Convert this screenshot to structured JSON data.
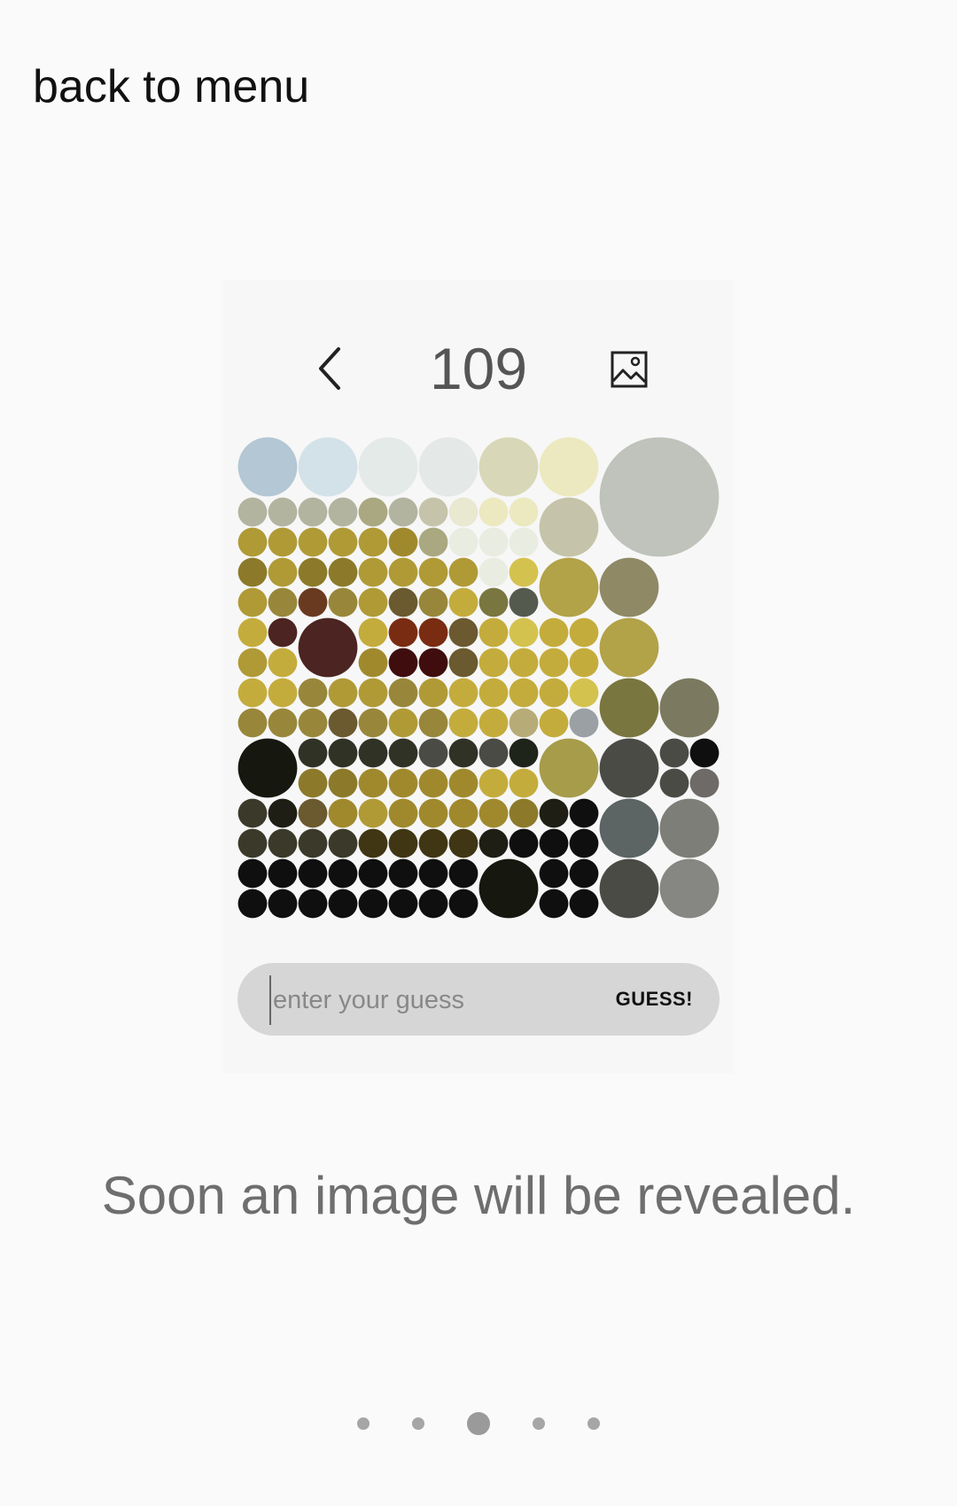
{
  "header": {
    "back_label": "back to menu"
  },
  "puzzle": {
    "counter": "109",
    "guess_placeholder": "enter your guess",
    "guess_value": "",
    "guess_button": "GUESS!",
    "icons": {
      "back": "chevron-left-icon",
      "image": "image-icon"
    },
    "circle_grid": {
      "cells": 16,
      "palette": {
        "a": "#b3c7d4",
        "b": "#d3e2e8",
        "c": "#e3eae8",
        "d": "#e4e8e6",
        "e": "#d8d8b8",
        "f": "#ece9c0",
        "g": "#bfc3bb",
        "h": "#b2b49f",
        "i": "#a9a880",
        "j": "#c5c4aa",
        "k": "#b09a36",
        "l": "#a0892d",
        "m": "#8c7a2a",
        "n": "#98873a",
        "o": "#c4ac3c",
        "p": "#d4c24e",
        "q": "#b2a248",
        "r": "#8f8966",
        "s": "#6a3a20",
        "t": "#4c2421",
        "u": "#7a2c12",
        "v": "#3f0d0d",
        "w": "#6b5a2f",
        "x": "#7a7640",
        "y": "#7b7a60",
        "z": "#555a4f",
        "A": "#3b3a2a",
        "B": "#16170f",
        "C": "#2f3225",
        "D": "#5c6464",
        "E": "#7e7e78",
        "F": "#a69c4a",
        "G": "#4b4b46",
        "H": "#1e1e14",
        "I": "#0f0f0f",
        "J": "#403614",
        "K": "#6d6a68",
        "L": "#868682",
        "M": "#6f6f6c",
        "N": "#b7ab77",
        "O": "#9aa0a4",
        "P": "#e9ece0",
        "Q": "#e9e8d0",
        "R": "#a9bfcc",
        "S": "#1f241b",
        "T": "#8c8f84"
      },
      "circles": [
        [
          0,
          0,
          2,
          "a"
        ],
        [
          2,
          0,
          2,
          "b"
        ],
        [
          4,
          0,
          2,
          "c"
        ],
        [
          6,
          0,
          2,
          "d"
        ],
        [
          8,
          0,
          2,
          "e"
        ],
        [
          10,
          0,
          2,
          "f"
        ],
        [
          12,
          0,
          4,
          "g"
        ],
        [
          0,
          2,
          1,
          "h"
        ],
        [
          1,
          2,
          1,
          "h"
        ],
        [
          2,
          2,
          1,
          "h"
        ],
        [
          3,
          2,
          1,
          "h"
        ],
        [
          4,
          2,
          1,
          "i"
        ],
        [
          5,
          2,
          1,
          "h"
        ],
        [
          6,
          2,
          1,
          "j"
        ],
        [
          7,
          2,
          1,
          "Q"
        ],
        [
          8,
          2,
          1,
          "f"
        ],
        [
          9,
          2,
          1,
          "f"
        ],
        [
          10,
          2,
          2,
          "j"
        ],
        [
          0,
          3,
          1,
          "k"
        ],
        [
          1,
          3,
          1,
          "k"
        ],
        [
          2,
          3,
          1,
          "k"
        ],
        [
          3,
          3,
          1,
          "k"
        ],
        [
          4,
          3,
          1,
          "k"
        ],
        [
          5,
          3,
          1,
          "l"
        ],
        [
          6,
          3,
          1,
          "i"
        ],
        [
          7,
          3,
          1,
          "P"
        ],
        [
          8,
          3,
          1,
          "P"
        ],
        [
          9,
          3,
          1,
          "P"
        ],
        [
          0,
          4,
          1,
          "m"
        ],
        [
          1,
          4,
          1,
          "k"
        ],
        [
          2,
          4,
          1,
          "m"
        ],
        [
          3,
          4,
          1,
          "m"
        ],
        [
          4,
          4,
          1,
          "k"
        ],
        [
          5,
          4,
          1,
          "k"
        ],
        [
          6,
          4,
          1,
          "k"
        ],
        [
          7,
          4,
          1,
          "k"
        ],
        [
          8,
          4,
          1,
          "P"
        ],
        [
          9,
          4,
          1,
          "p"
        ],
        [
          10,
          4,
          2,
          "q"
        ],
        [
          12,
          4,
          2,
          "r"
        ],
        [
          0,
          5,
          1,
          "k"
        ],
        [
          1,
          5,
          1,
          "n"
        ],
        [
          2,
          5,
          1,
          "s"
        ],
        [
          3,
          5,
          1,
          "n"
        ],
        [
          4,
          5,
          1,
          "k"
        ],
        [
          5,
          5,
          1,
          "w"
        ],
        [
          6,
          5,
          1,
          "n"
        ],
        [
          7,
          5,
          1,
          "o"
        ],
        [
          8,
          5,
          1,
          "x"
        ],
        [
          9,
          5,
          1,
          "z"
        ],
        [
          0,
          6,
          1,
          "o"
        ],
        [
          1,
          6,
          1,
          "t"
        ],
        [
          2,
          6,
          2,
          "t"
        ],
        [
          4,
          6,
          1,
          "o"
        ],
        [
          5,
          6,
          1,
          "u"
        ],
        [
          6,
          6,
          1,
          "u"
        ],
        [
          7,
          6,
          1,
          "w"
        ],
        [
          8,
          6,
          1,
          "o"
        ],
        [
          9,
          6,
          1,
          "p"
        ],
        [
          10,
          6,
          1,
          "o"
        ],
        [
          11,
          6,
          1,
          "o"
        ],
        [
          12,
          6,
          2,
          "q"
        ],
        [
          0,
          7,
          1,
          "k"
        ],
        [
          1,
          7,
          1,
          "o"
        ],
        [
          4,
          7,
          1,
          "l"
        ],
        [
          5,
          7,
          1,
          "v"
        ],
        [
          6,
          7,
          1,
          "v"
        ],
        [
          7,
          7,
          1,
          "w"
        ],
        [
          8,
          7,
          1,
          "o"
        ],
        [
          9,
          7,
          1,
          "o"
        ],
        [
          10,
          7,
          1,
          "o"
        ],
        [
          11,
          7,
          1,
          "o"
        ],
        [
          0,
          8,
          1,
          "o"
        ],
        [
          1,
          8,
          1,
          "o"
        ],
        [
          2,
          8,
          1,
          "n"
        ],
        [
          3,
          8,
          1,
          "k"
        ],
        [
          4,
          8,
          1,
          "k"
        ],
        [
          5,
          8,
          1,
          "n"
        ],
        [
          6,
          8,
          1,
          "k"
        ],
        [
          7,
          8,
          1,
          "o"
        ],
        [
          8,
          8,
          1,
          "o"
        ],
        [
          9,
          8,
          1,
          "o"
        ],
        [
          10,
          8,
          1,
          "o"
        ],
        [
          11,
          8,
          1,
          "p"
        ],
        [
          12,
          8,
          2,
          "x"
        ],
        [
          14,
          8,
          2,
          "y"
        ],
        [
          0,
          9,
          1,
          "n"
        ],
        [
          1,
          9,
          1,
          "n"
        ],
        [
          2,
          9,
          1,
          "n"
        ],
        [
          3,
          9,
          1,
          "w"
        ],
        [
          4,
          9,
          1,
          "n"
        ],
        [
          5,
          9,
          1,
          "k"
        ],
        [
          6,
          9,
          1,
          "n"
        ],
        [
          7,
          9,
          1,
          "o"
        ],
        [
          8,
          9,
          1,
          "o"
        ],
        [
          9,
          9,
          1,
          "N"
        ],
        [
          10,
          9,
          1,
          "o"
        ],
        [
          11,
          9,
          1,
          "O"
        ],
        [
          0,
          10,
          2,
          "B"
        ],
        [
          2,
          10,
          1,
          "C"
        ],
        [
          3,
          10,
          1,
          "C"
        ],
        [
          4,
          10,
          1,
          "C"
        ],
        [
          5,
          10,
          1,
          "C"
        ],
        [
          6,
          10,
          1,
          "G"
        ],
        [
          7,
          10,
          1,
          "C"
        ],
        [
          8,
          10,
          1,
          "G"
        ],
        [
          9,
          10,
          1,
          "S"
        ],
        [
          10,
          10,
          2,
          "F"
        ],
        [
          12,
          10,
          2,
          "G"
        ],
        [
          14,
          10,
          1,
          "G"
        ],
        [
          15,
          10,
          1,
          "I"
        ],
        [
          2,
          11,
          1,
          "m"
        ],
        [
          3,
          11,
          1,
          "m"
        ],
        [
          4,
          11,
          1,
          "l"
        ],
        [
          5,
          11,
          1,
          "l"
        ],
        [
          6,
          11,
          1,
          "l"
        ],
        [
          7,
          11,
          1,
          "l"
        ],
        [
          8,
          11,
          1,
          "o"
        ],
        [
          9,
          11,
          1,
          "o"
        ],
        [
          14,
          11,
          1,
          "G"
        ],
        [
          15,
          11,
          1,
          "K"
        ],
        [
          0,
          12,
          1,
          "A"
        ],
        [
          1,
          12,
          1,
          "H"
        ],
        [
          2,
          12,
          1,
          "w"
        ],
        [
          3,
          12,
          1,
          "l"
        ],
        [
          4,
          12,
          1,
          "k"
        ],
        [
          5,
          12,
          1,
          "l"
        ],
        [
          6,
          12,
          1,
          "l"
        ],
        [
          7,
          12,
          1,
          "l"
        ],
        [
          8,
          12,
          1,
          "l"
        ],
        [
          9,
          12,
          1,
          "m"
        ],
        [
          10,
          12,
          1,
          "H"
        ],
        [
          11,
          12,
          1,
          "I"
        ],
        [
          12,
          12,
          2,
          "D"
        ],
        [
          14,
          12,
          2,
          "E"
        ],
        [
          0,
          13,
          1,
          "A"
        ],
        [
          1,
          13,
          1,
          "A"
        ],
        [
          2,
          13,
          1,
          "A"
        ],
        [
          3,
          13,
          1,
          "A"
        ],
        [
          4,
          13,
          1,
          "J"
        ],
        [
          5,
          13,
          1,
          "J"
        ],
        [
          6,
          13,
          1,
          "J"
        ],
        [
          7,
          13,
          1,
          "J"
        ],
        [
          8,
          13,
          1,
          "H"
        ],
        [
          9,
          13,
          1,
          "I"
        ],
        [
          10,
          13,
          1,
          "I"
        ],
        [
          11,
          13,
          1,
          "I"
        ],
        [
          0,
          14,
          1,
          "I"
        ],
        [
          1,
          14,
          1,
          "I"
        ],
        [
          2,
          14,
          1,
          "I"
        ],
        [
          3,
          14,
          1,
          "I"
        ],
        [
          4,
          14,
          1,
          "I"
        ],
        [
          5,
          14,
          1,
          "I"
        ],
        [
          6,
          14,
          1,
          "I"
        ],
        [
          7,
          14,
          1,
          "I"
        ],
        [
          8,
          14,
          2,
          "B"
        ],
        [
          10,
          14,
          1,
          "I"
        ],
        [
          11,
          14,
          1,
          "I"
        ],
        [
          12,
          14,
          2,
          "G"
        ],
        [
          14,
          14,
          2,
          "L"
        ],
        [
          0,
          15,
          1,
          "I"
        ],
        [
          1,
          15,
          1,
          "I"
        ],
        [
          2,
          15,
          1,
          "I"
        ],
        [
          3,
          15,
          1,
          "I"
        ],
        [
          4,
          15,
          1,
          "I"
        ],
        [
          5,
          15,
          1,
          "I"
        ],
        [
          6,
          15,
          1,
          "I"
        ],
        [
          7,
          15,
          1,
          "I"
        ],
        [
          10,
          15,
          1,
          "I"
        ],
        [
          11,
          15,
          1,
          "I"
        ]
      ]
    }
  },
  "footer": {
    "message": "Soon an image will be revealed."
  },
  "pager": {
    "count": 5,
    "active": 2
  }
}
